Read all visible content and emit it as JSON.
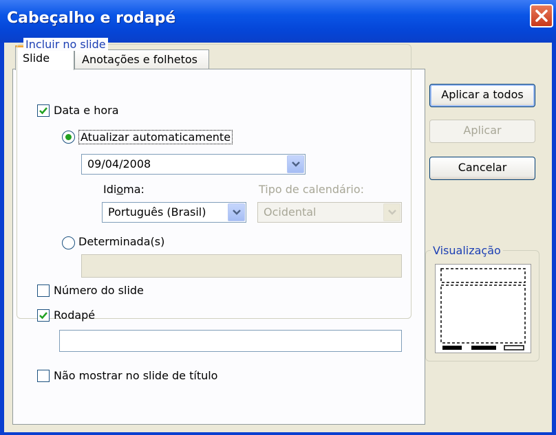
{
  "window": {
    "title": "Cabeçalho e rodapé"
  },
  "tabs": [
    {
      "label": "Slide",
      "active": true
    },
    {
      "label": "Anotações e folhetos",
      "active": false
    }
  ],
  "group": {
    "legend": "Incluir no slide"
  },
  "date_time": {
    "label": "Data e hora",
    "checked": true,
    "auto_update": {
      "label": "Atualizar automaticamente",
      "selected": true,
      "date_value": "09/04/2008"
    },
    "language": {
      "label": "Idioma:",
      "value": "Português (Brasil)"
    },
    "calendar_type": {
      "label": "Tipo de calendário:",
      "value": "Ocidental",
      "disabled": true
    },
    "fixed": {
      "label": "Determinada(s)",
      "selected": false,
      "value": ""
    }
  },
  "slide_number": {
    "label": "Número do slide",
    "checked": false
  },
  "footer": {
    "label": "Rodapé",
    "checked": true,
    "value": ""
  },
  "hide_on_title": {
    "label": "Não mostrar no slide de título",
    "checked": false
  },
  "buttons": {
    "apply_all": "Aplicar a todos",
    "apply": "Aplicar",
    "cancel": "Cancelar"
  },
  "preview": {
    "legend": "Visualização"
  },
  "colors": {
    "accent": "#0a55e6",
    "check": "#21a121",
    "group_legend": "#1c3fb4"
  }
}
